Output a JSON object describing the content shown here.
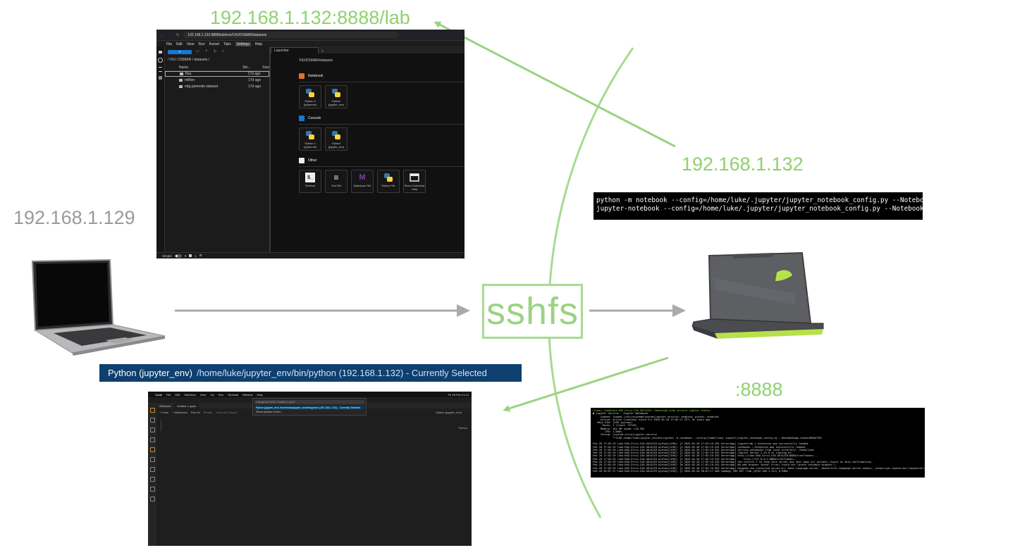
{
  "labels": {
    "lab_url": "192.168.1.132:8888/lab",
    "server_ip": "192.168.1.132",
    "client_ip": "192.168.1.129",
    "port": ":8888",
    "sshfs": "sshfs"
  },
  "colors": {
    "accent_green": "#8fd16f",
    "arrow_gray": "#aaaaaa",
    "kernel_bar_blue": "#0e3f6e"
  },
  "jupyterlab": {
    "address": "192.168.1.132:8888/lab/tree/VIU/DSMAR/datasets",
    "menu": [
      "File",
      "Edit",
      "View",
      "Run",
      "Kernel",
      "Tabs",
      "Settings",
      "Help"
    ],
    "new_button": "+",
    "breadcrumb": "/ VIU / DSMAR / datasets /",
    "columns": {
      "name": "Name",
      "modified": "Mo...",
      "size": "Size"
    },
    "files": [
      {
        "name": "fma",
        "modified": "17d ago"
      },
      {
        "name": "million",
        "modified": "17d ago"
      },
      {
        "name": "mtg-jamendo-dataset",
        "modified": "17d ago"
      }
    ],
    "tab_label": "Launcher",
    "launcher_path": "VIU/DSMAR/datasets",
    "sections": {
      "notebook": "Notebook",
      "console": "Console",
      "other": "Other"
    },
    "notebook_cards": [
      "Python 3 (ipykernel)",
      "Python (jupyter_env)"
    ],
    "console_cards": [
      "Python 3 (ipykernel)",
      "Python (jupyter_env)"
    ],
    "other_cards": [
      "Terminal",
      "Text File",
      "Markdown File",
      "Python File",
      "Show Contextual Help"
    ],
    "status": {
      "mode": "Simple",
      "count1": "0",
      "count2": "1"
    }
  },
  "command": {
    "line1": "python -m notebook --config=/home/luke/.jupyter/jupyter_notebook_config.py --NotebookApp.token",
    "line2": "jupyter-notebook --config=/home/luke/.jupyter/jupyter_notebook_config.py --NotebookApp.token='"
  },
  "terminal": {
    "lines": [
      "[luke] luke@luke-ROG-Strix-G16-G614JIR:~/Desktop$ sudo service jupyter status",
      "● jupyter.service - Jupyter Notebook",
      "     Loaded: loaded (/etc/systemd/system/jupyter.service; enabled; preset: enabled)",
      "     Active: active (running) since Fri 2025-02-28 17:02:17 CET; 3h 11min ago",
      "   Main PID: 1190 (python)",
      "      Tasks: 1 (limit: 37749)",
      "     Memory: 101.9M (peak: 110.3M)",
      "        CPU: 1.066s",
      "     CGroup: /system.slice/jupyter.service",
      "             └─1190 /home/luke/jupyter_env/bin/python -m notebook --config=/home/luke/.jupyter/jupyter_notebook_config.py --NotebookApp.token=REDACTED",
      "",
      "Feb 28 17:02:19 luke-ROG-Strix-G16-G614JIR python[1190]: [I 2025-02-28 17:02:19.432 ServerApp] jupyterlab | extension was successfully loaded.",
      "Feb 28 17:02:19 luke-ROG-Strix-G16-G614JIR python[1190]: [I 2025-02-28 17:02:19.432 ServerApp] notebook | extension was successfully loaded.",
      "Feb 28 17:02:19 luke-ROG-Strix-G16-G614JIR python[1190]: [I 2025-02-28 17:02:19.432 ServerApp] Serving notebooks from local directory: /home/luke",
      "Feb 28 17:02:19 luke-ROG-Strix-G16-G614JIR python[1190]: [I 2025-02-28 17:02:19.432 ServerApp] Jupyter Server 2.15.0 is running at:",
      "Feb 28 17:02:19 luke-ROG-Strix-G16-G614JIR python[1190]: [I 2025-02-28 17:02:19.432 ServerApp] http://luke-ROG-Strix-G16-G614JIR:8888/tree?token=...",
      "Feb 28 17:02:19 luke-ROG-Strix-G16-G614JIR python[1190]: [I 2025-02-28 17:02:19.432 ServerApp]     http://127.0.0.1:8888/tree?token=...",
      "Feb 28 17:02:19 luke-ROG-Strix-G16-G614JIR python[1190]: [I 2025-02-28 17:02:19.432 ServerApp] Use Control-C to stop this server and shut down all kernels (twice to skip confirmation).",
      "Feb 28 17:02:19 luke-ROG-Strix-G16-G614JIR python[1190]: [W 2025-02-28 17:02:19.441 ServerApp] No web browser found: Error('could not locate runnable browser').",
      "Feb 28 17:02:19 luke-ROG-Strix-G16-G614JIR python[1190]: [I 2025-02-28 17:02:19.853 ServerApp] Skipped non-installed server(s): bash-language-server, dockerfile-language-server-nodejs, javascript-typescript-langserver, jedi-language-server",
      "Feb 28 20:07:17 luke-ROG-Strix-G16-G614JIR python[1190]: [I 2025-02-28 20:07:17.468 LabApp] 302 GET /lab (@192.168.1.121) 0.58ms"
    ]
  },
  "kernel_bar": {
    "name": "Python (jupyter_env)",
    "path": "/home/luke/jupyter_env/bin/python (192.168.1.132) - Currently Selected"
  },
  "vscode": {
    "menu": [
      "Code",
      "File",
      "Edit",
      "Selection",
      "View",
      "Go",
      "Run",
      "Terminal",
      "Window",
      "Help"
    ],
    "clock": "Fri 28 Feb  21:12",
    "tabs": {
      "welcome": "Welcome",
      "notebook": "Untitled-1.ipynb"
    },
    "toolbar": [
      "+ Code",
      "+ Markdown",
      "Run All",
      "Restart",
      "Clear All Outputs"
    ],
    "quick_pick": {
      "placeholder": "Change kernel for 'Untitled-1.ipynb'",
      "selected": "Python (jupyter_env)  /home/luke/jupyter_env/bin/python (192.168.1.132) - Currently Selected",
      "other": "Select Another Kernel..."
    },
    "kernel_label": "Python (jupyter_env)",
    "cell_lang": "Python"
  }
}
